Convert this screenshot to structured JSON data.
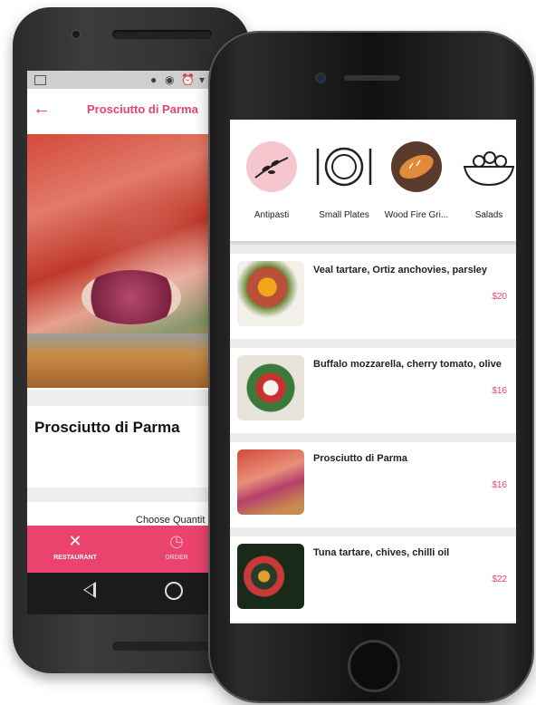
{
  "android": {
    "title": "Prosciutto di Parma",
    "dish_name": "Prosciutto di Parma",
    "choose_quantity": "Choose Quantit",
    "tabs": [
      {
        "label": "RESTAURANT",
        "icon": "fork-knife-icon"
      },
      {
        "label": "ORDER",
        "icon": "order-clock-icon"
      }
    ]
  },
  "iphone": {
    "categories": [
      {
        "label": "Antipasti",
        "icon": "olive-branch-icon"
      },
      {
        "label": "Small Plates",
        "icon": "plate-cutlery-icon"
      },
      {
        "label": "Wood Fire Gri...",
        "icon": "bread-icon"
      },
      {
        "label": "Salads",
        "icon": "salad-bowl-icon"
      }
    ],
    "menu_items": [
      {
        "name": "Veal tartare, Ortiz anchovies, parsley",
        "price": "$20"
      },
      {
        "name": "Buffalo mozzarella, cherry tomato, olive",
        "price": "$16"
      },
      {
        "name": "Prosciutto di Parma",
        "price": "$16"
      },
      {
        "name": "Tuna tartare, chives, chilli oil",
        "price": "$22"
      }
    ]
  },
  "colors": {
    "accent": "#e9436e"
  }
}
